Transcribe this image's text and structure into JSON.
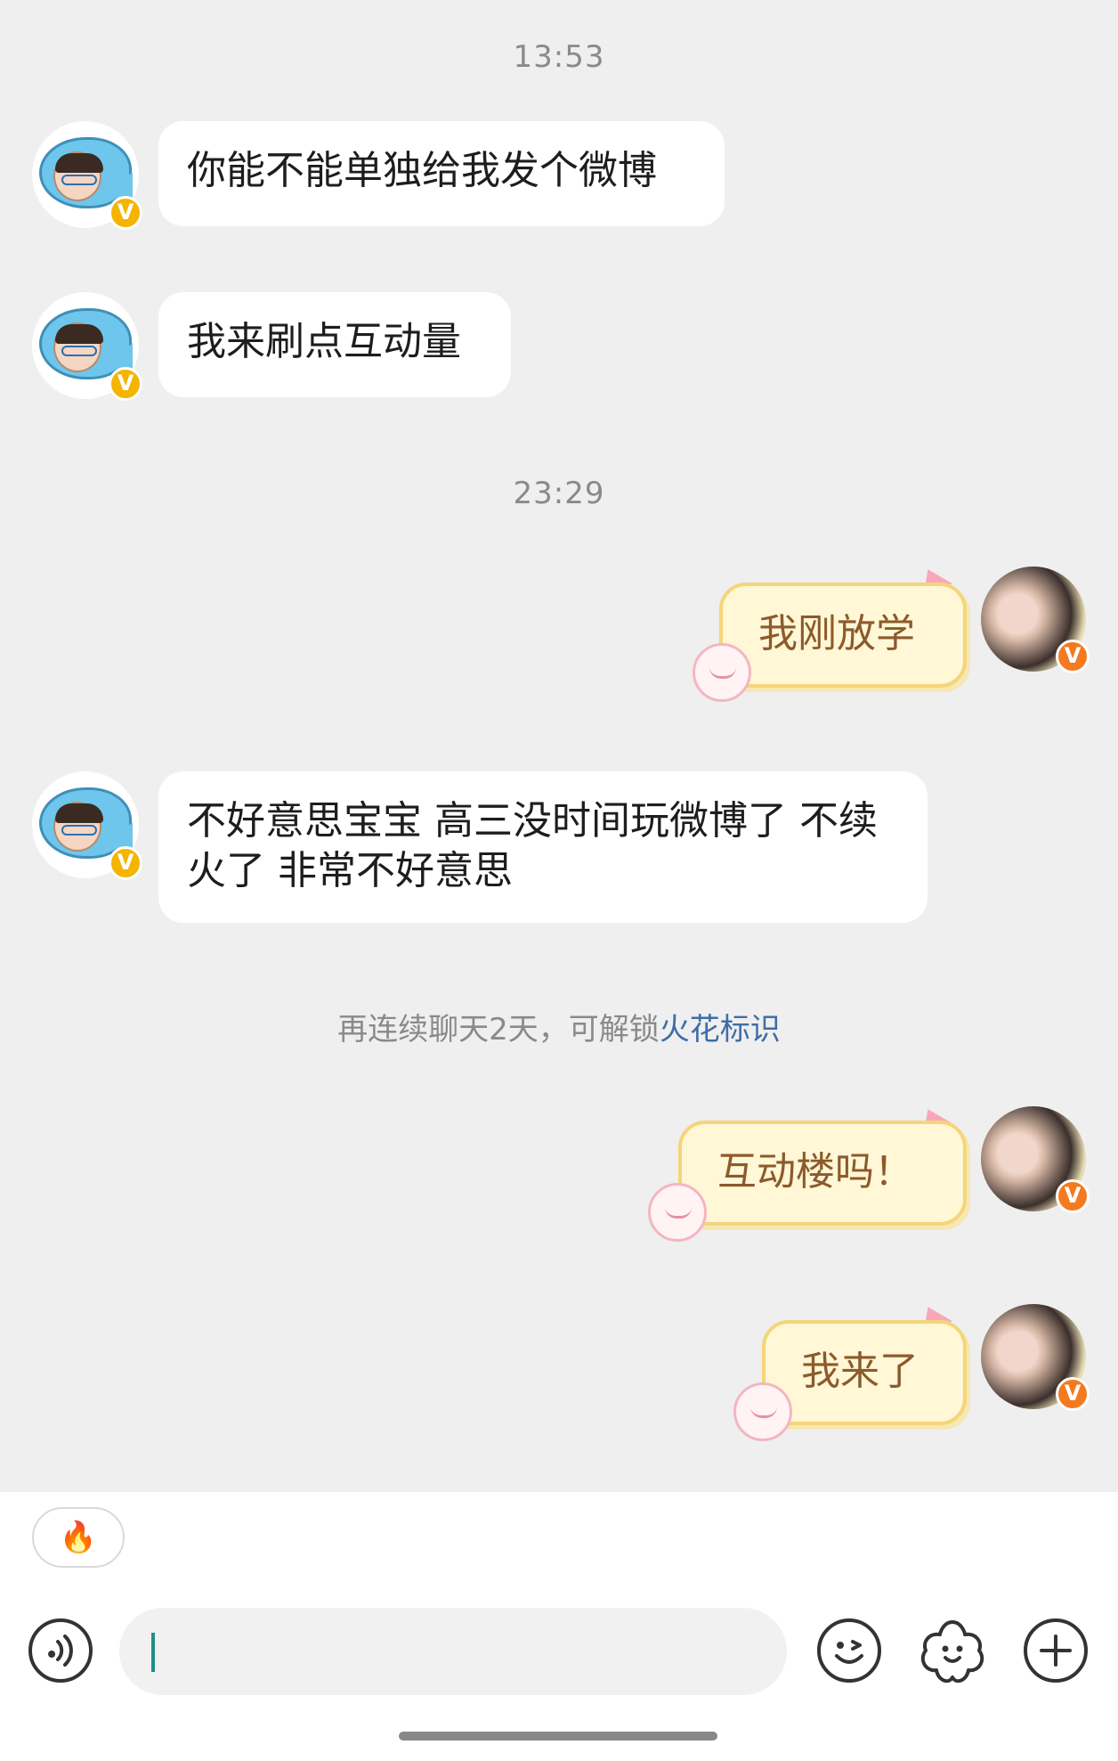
{
  "timestamps": [
    "13:53",
    "23:29"
  ],
  "messages": [
    {
      "side": "left",
      "text": "你能不能单独给我发个微博"
    },
    {
      "side": "left",
      "text": "我来刷点互动量"
    },
    {
      "side": "right",
      "text": "我刚放学"
    },
    {
      "side": "left",
      "text": "不好意思宝宝 高三没时间玩微博了 不续火了 非常不好意思"
    },
    {
      "side": "right",
      "text": "互动楼吗！"
    },
    {
      "side": "right",
      "text": "我来了"
    }
  ],
  "system_notice": {
    "prefix": "再连续聊天2天，可解锁",
    "link": "火花标识"
  },
  "avatars": {
    "other_badge": "V",
    "self_badge": "V"
  },
  "bottom_bar": {
    "fire_chip": "🔥",
    "input_value": "",
    "icons": [
      "voice-icon",
      "emoji-icon",
      "sticker-icon",
      "plus-icon"
    ]
  },
  "colors": {
    "background": "#efefef",
    "bubble_left": "#ffffff",
    "bubble_right": "#fff7d6",
    "link": "#3d6ea8",
    "badge_gold": "#f5b400",
    "badge_orange": "#f47a1f"
  }
}
